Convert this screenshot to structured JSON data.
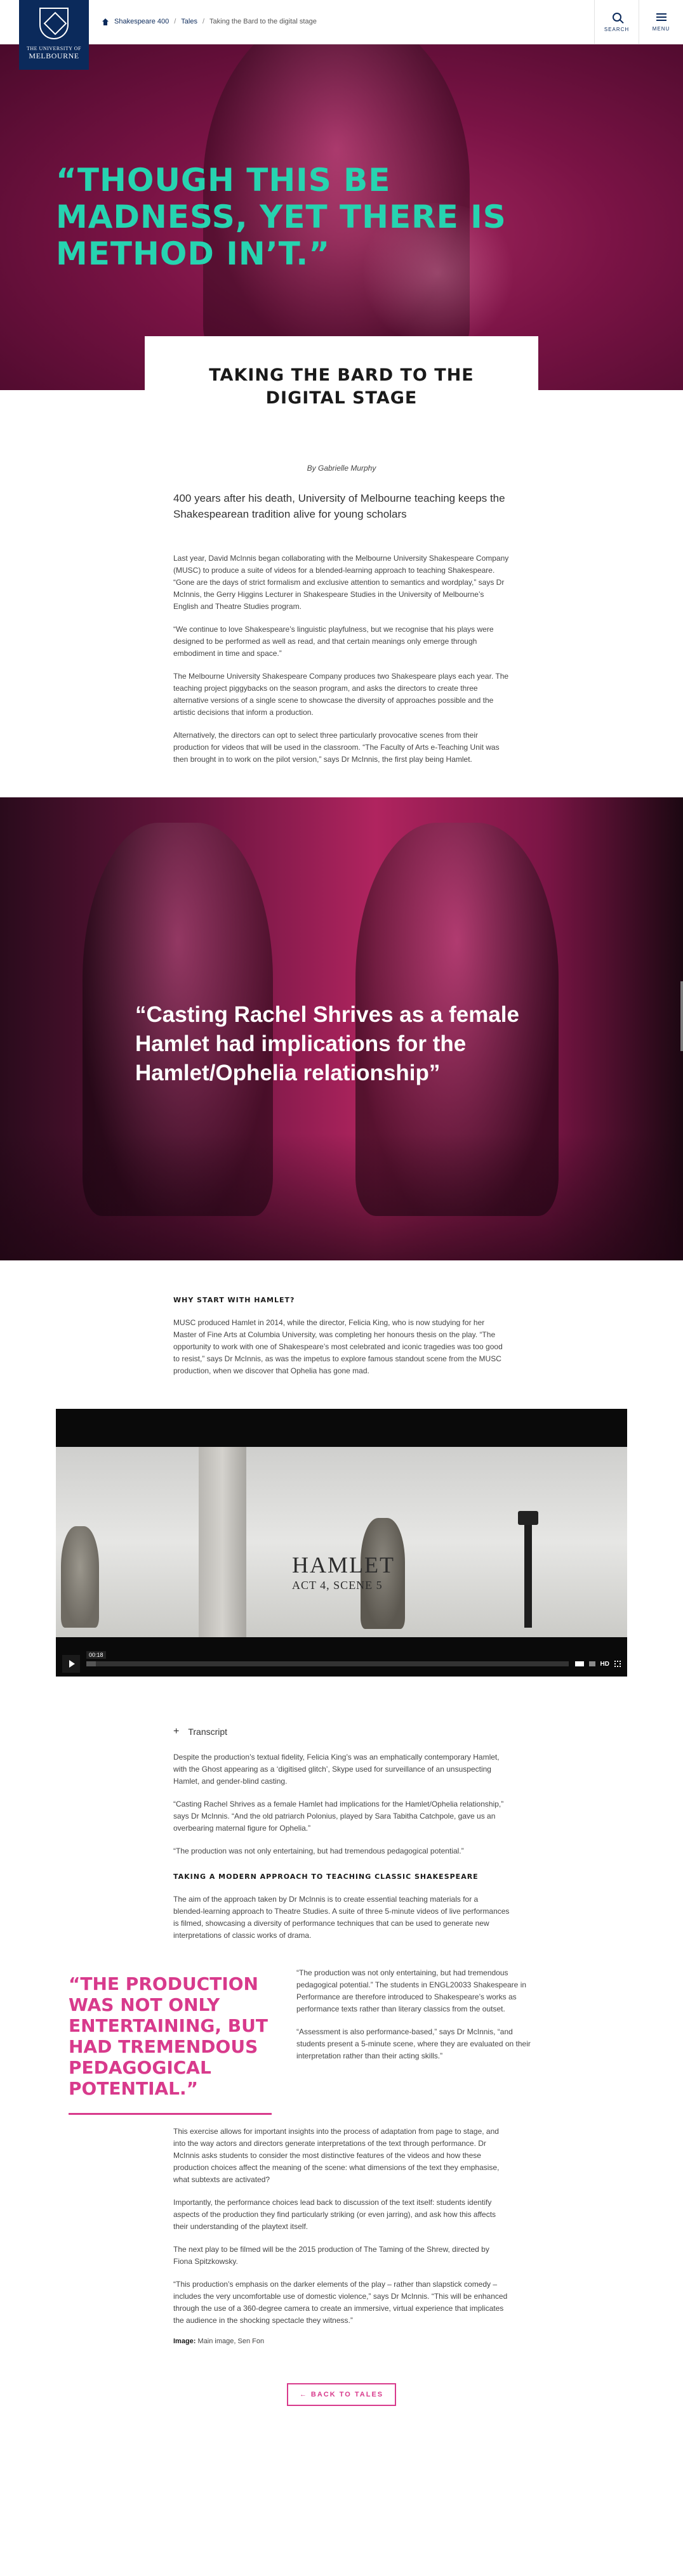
{
  "header": {
    "logo_line1": "THE UNIVERSITY OF",
    "logo_line2": "MELBOURNE",
    "breadcrumb": [
      "Shakespeare 400",
      "Tales",
      "Taking the Bard to the digital stage"
    ],
    "breadcrumb_sep": "/",
    "search_label": "SEARCH",
    "menu_label": "MENU"
  },
  "hero": {
    "quote": "“Though this be madness, yet there is method in’t.”",
    "title": "Taking the Bard to the digital stage"
  },
  "article": {
    "byline": "By Gabrielle Murphy",
    "intro": "400 years after his death, University of Melbourne teaching keeps the Shakespearean tradition alive for young scholars",
    "paragraphs_1": [
      "Last year, David McInnis began collaborating with the Melbourne University Shakespeare Company (MUSC) to produce a suite of videos for a blended-learning approach to teaching Shakespeare. “Gone are the days of strict formalism and exclusive attention to semantics and wordplay,” says Dr McInnis, the Gerry Higgins Lecturer in Shakespeare Studies in the University of Melbourne’s English and Theatre Studies program.",
      "“We continue to love Shakespeare’s linguistic playfulness, but we recognise that his plays were designed to be performed as well as read, and that certain meanings only emerge through embodiment in time and space.”",
      "The Melbourne University Shakespeare Company produces two Shakespeare plays each year. The teaching project piggybacks on the season program, and asks the directors to create three alternative versions of a single scene to showcase the diversity of approaches possible and the artistic decisions that inform a production.",
      "Alternatively, the directors can opt to select three particularly provocative scenes from their production for videos that will be used in the classroom. “The Faculty of Arts e-Teaching Unit was then brought in to work on the pilot version,” says Dr McInnis, the first play being Hamlet."
    ],
    "band_quote": "“Casting Rachel Shrives as a female Hamlet had implications for the Hamlet/Ophelia relationship”",
    "section2_heading": "Why start with Hamlet?",
    "section2_para": "MUSC produced Hamlet in 2014, while the director, Felicia King, who is now studying for her Master of Fine Arts at Columbia University, was completing her honours thesis on the play. “The opportunity to work with one of Shakespeare’s most celebrated and iconic tragedies was too good to resist,” says Dr McInnis, as was the impetus to explore famous standout scene from the MUSC production, when we discover that Ophelia has gone mad.",
    "video": {
      "title": "HAMLET",
      "subtitle": "ACT 4, SCENE 5",
      "time": "00:18",
      "hd_label": "HD",
      "progress": 0.02
    },
    "transcript_label": "Transcript",
    "paragraphs_3": [
      "Despite the production’s textual fidelity, Felicia King’s was an emphatically contemporary Hamlet, with the Ghost appearing as a ‘digitised glitch’, Skype used for surveillance of an unsuspecting Hamlet, and gender-blind casting.",
      "“Casting Rachel Shrives as a female Hamlet had implications for the Hamlet/Ophelia relationship,” says Dr McInnis. “And the old patriarch Polonius, played by Sara Tabitha Catchpole, gave us an overbearing maternal figure for Ophelia.”",
      "“The production was not only entertaining, but had tremendous pedagogical potential.”"
    ],
    "section3_heading": "Taking a modern approach to teaching classic Shakespeare",
    "section3_para": "The aim of the approach taken by Dr McInnis is to create essential teaching materials for a blended-learning approach to Theatre Studies. A suite of three 5-minute videos of live performances is filmed, showcasing a diversity of performance techniques that can be used to generate new interpretations of classic works of drama.",
    "pull_quote": "“The production was not only entertaining, but had tremendous pedagogical potential.”",
    "split_paras": [
      "“The production was not only entertaining, but had tremendous pedagogical potential.” The students in ENGL20033 Shakespeare in Performance are therefore introduced to Shakespeare’s works as performance texts rather than literary classics from the outset.",
      "“Assessment is also performance-based,” says Dr McInnis, “and students present a 5-minute scene, where they are evaluated on their interpretation rather than their acting skills.”"
    ],
    "paragraphs_4": [
      "This exercise allows for important insights into the process of adaptation from page to stage, and into the way actors and directors generate interpretations of the text through performance. Dr McInnis asks students to consider the most distinctive features of the videos and how these production choices affect the meaning of the scene: what dimensions of the text they emphasise, what subtexts are activated?",
      "Importantly, the performance choices lead back to discussion of the text itself: students identify aspects of the production they find particularly striking (or even jarring), and ask how this affects their understanding of the playtext itself.",
      "The next play to be filmed will be the 2015 production of The Taming of the Shrew, directed by Fiona Spitzkowsky.",
      "“This production’s emphasis on the darker elements of the play – rather than slapstick comedy – includes the very uncomfortable use of domestic violence,” says Dr McInnis. “This will be enhanced through the use of a 360-degree camera to create an immersive, virtual experience that implicates the audience in the shocking spectacle they witness.”"
    ],
    "image_credit_label": "Image:",
    "image_credit_value": " Main image, Sen Fon",
    "back_label": "← Back to tales"
  },
  "colors": {
    "navy": "#0b2a5b",
    "teal_quote": "#27d3b0",
    "magenta": "#d83a8c"
  }
}
